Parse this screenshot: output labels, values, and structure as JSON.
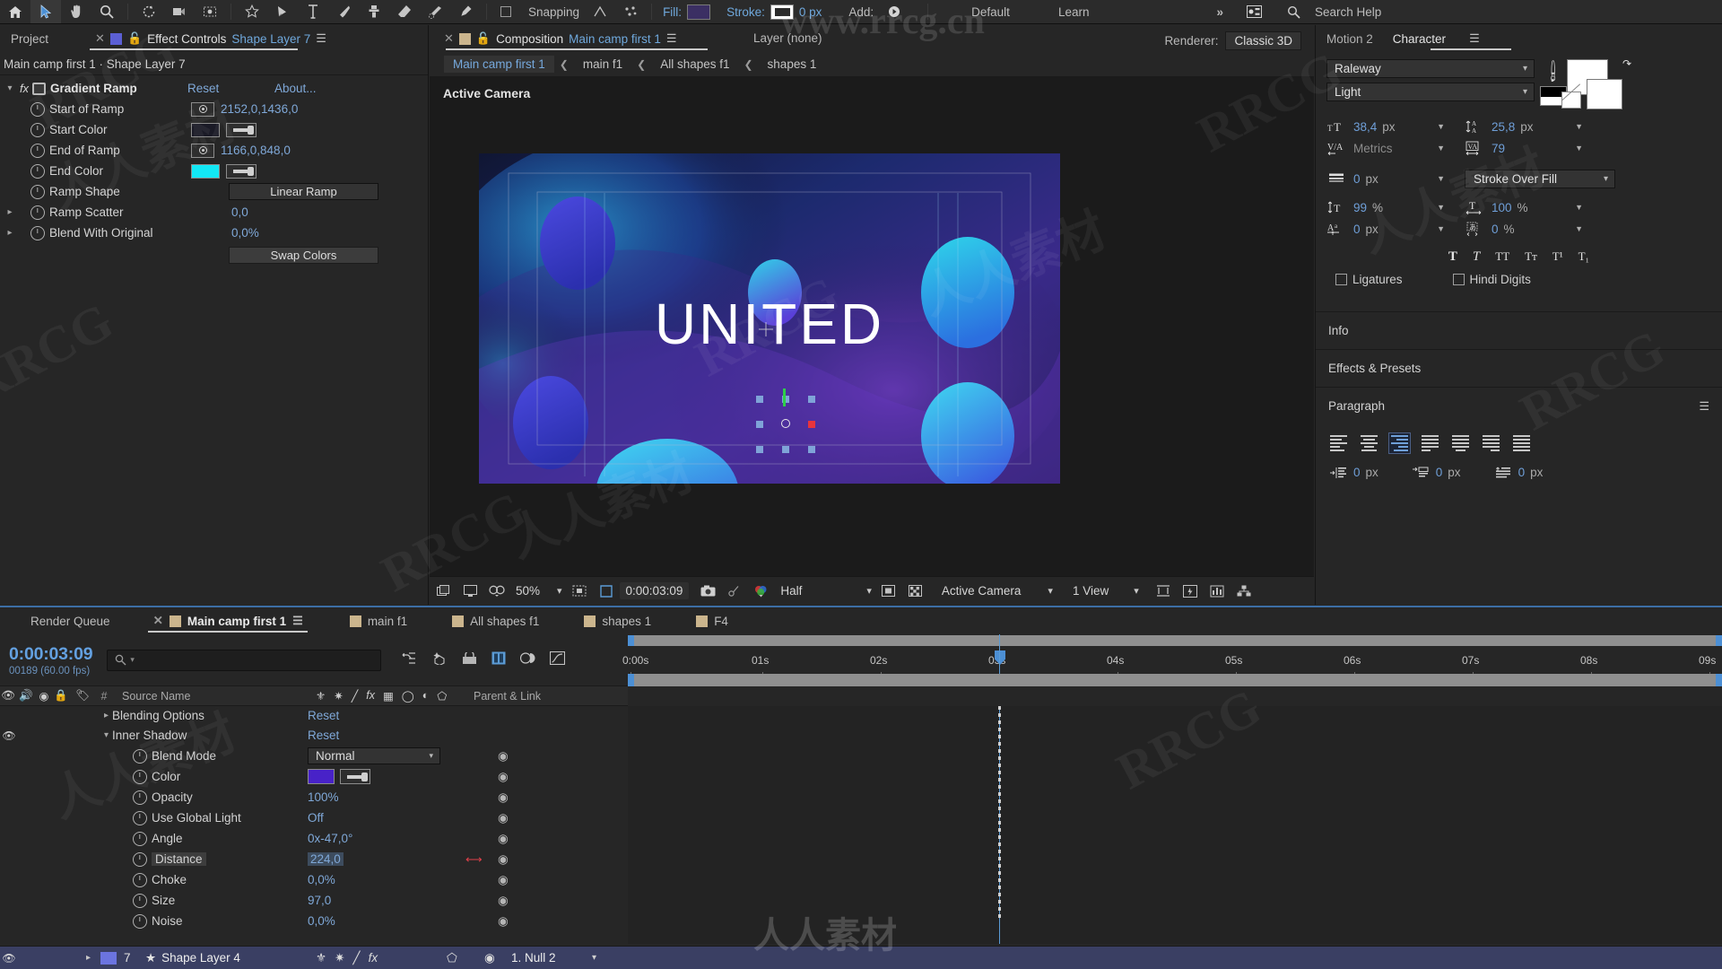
{
  "toolbar": {
    "tools": [
      "home-icon",
      "selection-tool",
      "hand-tool",
      "zoom-tool",
      "rotation-tool",
      "pan-behind-tool",
      "mask-tool",
      "shape-tool",
      "pen-tool",
      "type-tool",
      "brush-tool",
      "clone-stamp-tool",
      "eraser-tool",
      "roto-brush-tool",
      "puppet-pin-tool"
    ],
    "snapping_label": "Snapping",
    "fill_label": "Fill:",
    "fill_color": "#3b2f63",
    "stroke_label": "Stroke:",
    "stroke_color": "#ffffff",
    "stroke_width": "0 px",
    "add_label": "Add:",
    "workspace_default": "Default",
    "workspace_learn": "Learn",
    "overflow": "»",
    "search_help": "Search Help"
  },
  "effect_controls": {
    "tabs": [
      {
        "label": "Project",
        "active": false,
        "closable": true
      },
      {
        "label": "Effect Controls ",
        "highlight": "Shape Layer 7",
        "active": true,
        "closable": true
      }
    ],
    "subtitle": "Main camp first 1 · Shape Layer 7",
    "effect_name": "Gradient Ramp",
    "reset_label": "Reset",
    "about_label": "About...",
    "properties": [
      {
        "name": "Start of Ramp",
        "value": "2152,0,1436,0",
        "kind": "point"
      },
      {
        "name": "Start Color",
        "value": "",
        "kind": "color",
        "color": "#1a1a26"
      },
      {
        "name": "End of Ramp",
        "value": "1166,0,848,0",
        "kind": "point"
      },
      {
        "name": "End Color",
        "value": "",
        "kind": "color",
        "color": "#12e8f5"
      },
      {
        "name": "Ramp Shape",
        "value": "Linear Ramp",
        "kind": "dropdown"
      },
      {
        "name": "Ramp Scatter",
        "value": "0,0",
        "kind": "num",
        "expandable": true
      },
      {
        "name": "Blend With Original",
        "value": "0,0%",
        "kind": "num",
        "expandable": true
      }
    ],
    "swap_colors_label": "Swap Colors"
  },
  "composition": {
    "tab_prefix": "Composition ",
    "tab_name": "Main camp first 1",
    "layer_label": "Layer (none)",
    "renderer_label": "Renderer:",
    "renderer_value": "Classic 3D",
    "breadcrumb": [
      "Main camp first 1",
      "main f1",
      "All shapes f1",
      "shapes 1"
    ],
    "view_label": "Active Camera",
    "artwork_text": "UNITED",
    "bottom_bar": {
      "magnification": "50%",
      "time": "0:00:03:09",
      "resolution": "Half",
      "camera": "Active Camera",
      "views": "1 View"
    }
  },
  "right_panel": {
    "tabs": [
      {
        "label": "Motion 2",
        "active": false
      },
      {
        "label": "Character",
        "active": true
      }
    ],
    "character": {
      "font_family": "Raleway",
      "font_style": "Light",
      "font_size": "38,4",
      "font_size_unit": "px",
      "leading": "25,8",
      "leading_unit": "px",
      "kerning": "Metrics",
      "tracking": "79",
      "stroke_width": "0",
      "stroke_width_unit": "px",
      "stroke_order": "Stroke Over Fill",
      "vertical_scale": "99",
      "vertical_scale_unit": "%",
      "horizontal_scale": "100",
      "horizontal_scale_unit": "%",
      "baseline_shift": "0",
      "baseline_shift_unit": "px",
      "tsume": "0",
      "tsume_unit": "%",
      "styles": [
        "T",
        "T",
        "TT",
        "Tt",
        "T¹",
        "T₁"
      ],
      "ligatures_label": "Ligatures",
      "hindi_digits_label": "Hindi Digits",
      "fill_color": "#ffffff",
      "stroke_color": "#ffffff"
    },
    "accordions": [
      {
        "label": "Info"
      },
      {
        "label": "Effects & Presets"
      }
    ],
    "paragraph": {
      "label": "Paragraph",
      "alignments": [
        "align-left",
        "align-center",
        "align-right",
        "justify-last-left",
        "justify-last-center",
        "justify-last-right",
        "justify-all"
      ],
      "active_alignment_index": 2,
      "indents": [
        {
          "name": "indent-left-margin",
          "value": "0",
          "unit": "px"
        },
        {
          "name": "indent-right-margin",
          "value": "0",
          "unit": "px"
        },
        {
          "name": "indent-first-line",
          "value": "0",
          "unit": "px"
        }
      ]
    }
  },
  "timeline": {
    "tabs": [
      {
        "label": "Render Queue",
        "active": false,
        "swatch": false
      },
      {
        "label": "Main camp first 1",
        "active": true,
        "swatch": true,
        "closable": true
      },
      {
        "label": "main f1",
        "active": false,
        "swatch": true
      },
      {
        "label": "All shapes f1",
        "active": false,
        "swatch": true
      },
      {
        "label": "shapes 1",
        "active": false,
        "swatch": true
      },
      {
        "label": "F4",
        "active": false,
        "swatch": true
      }
    ],
    "current_time": "0:00:03:09",
    "frame_info": "00189 (60.00 fps)",
    "search_placeholder": "",
    "columns": [
      "Source Name",
      "Parent & Link"
    ],
    "ruler_labels": [
      "0:00s",
      "01s",
      "02s",
      "03s",
      "04s",
      "05s",
      "06s",
      "07s",
      "08s",
      "09s"
    ],
    "rows": [
      {
        "indent": 2,
        "name": "Blending Options",
        "value": "Reset",
        "kind": "group",
        "expandable": true,
        "expanded": false,
        "eye": false
      },
      {
        "indent": 2,
        "name": "Inner Shadow",
        "value": "Reset",
        "kind": "group",
        "expandable": true,
        "expanded": true,
        "eye": true
      },
      {
        "indent": 4,
        "name": "Blend Mode",
        "value": "Normal",
        "kind": "dropdown"
      },
      {
        "indent": 4,
        "name": "Color",
        "value": "",
        "kind": "color",
        "color": "#4822c8"
      },
      {
        "indent": 4,
        "name": "Opacity",
        "value": "100%",
        "kind": "num"
      },
      {
        "indent": 4,
        "name": "Use Global Light",
        "value": "Off",
        "kind": "num"
      },
      {
        "indent": 4,
        "name": "Angle",
        "value": "0x-47,0°",
        "kind": "num"
      },
      {
        "indent": 4,
        "name": "Distance",
        "value": "224,0",
        "kind": "num",
        "selected": true
      },
      {
        "indent": 4,
        "name": "Choke",
        "value": "0,0%",
        "kind": "num"
      },
      {
        "indent": 4,
        "name": "Size",
        "value": "97,0",
        "kind": "num"
      },
      {
        "indent": 4,
        "name": "Noise",
        "value": "0,0%",
        "kind": "num"
      }
    ],
    "bottom_layer": {
      "index": "7",
      "name": "Shape Layer 4",
      "parent": "1. Null 2",
      "color": "#6b74e0"
    }
  },
  "watermarks": [
    "www.rrcg.cn",
    "RRCG",
    "人人素材"
  ]
}
